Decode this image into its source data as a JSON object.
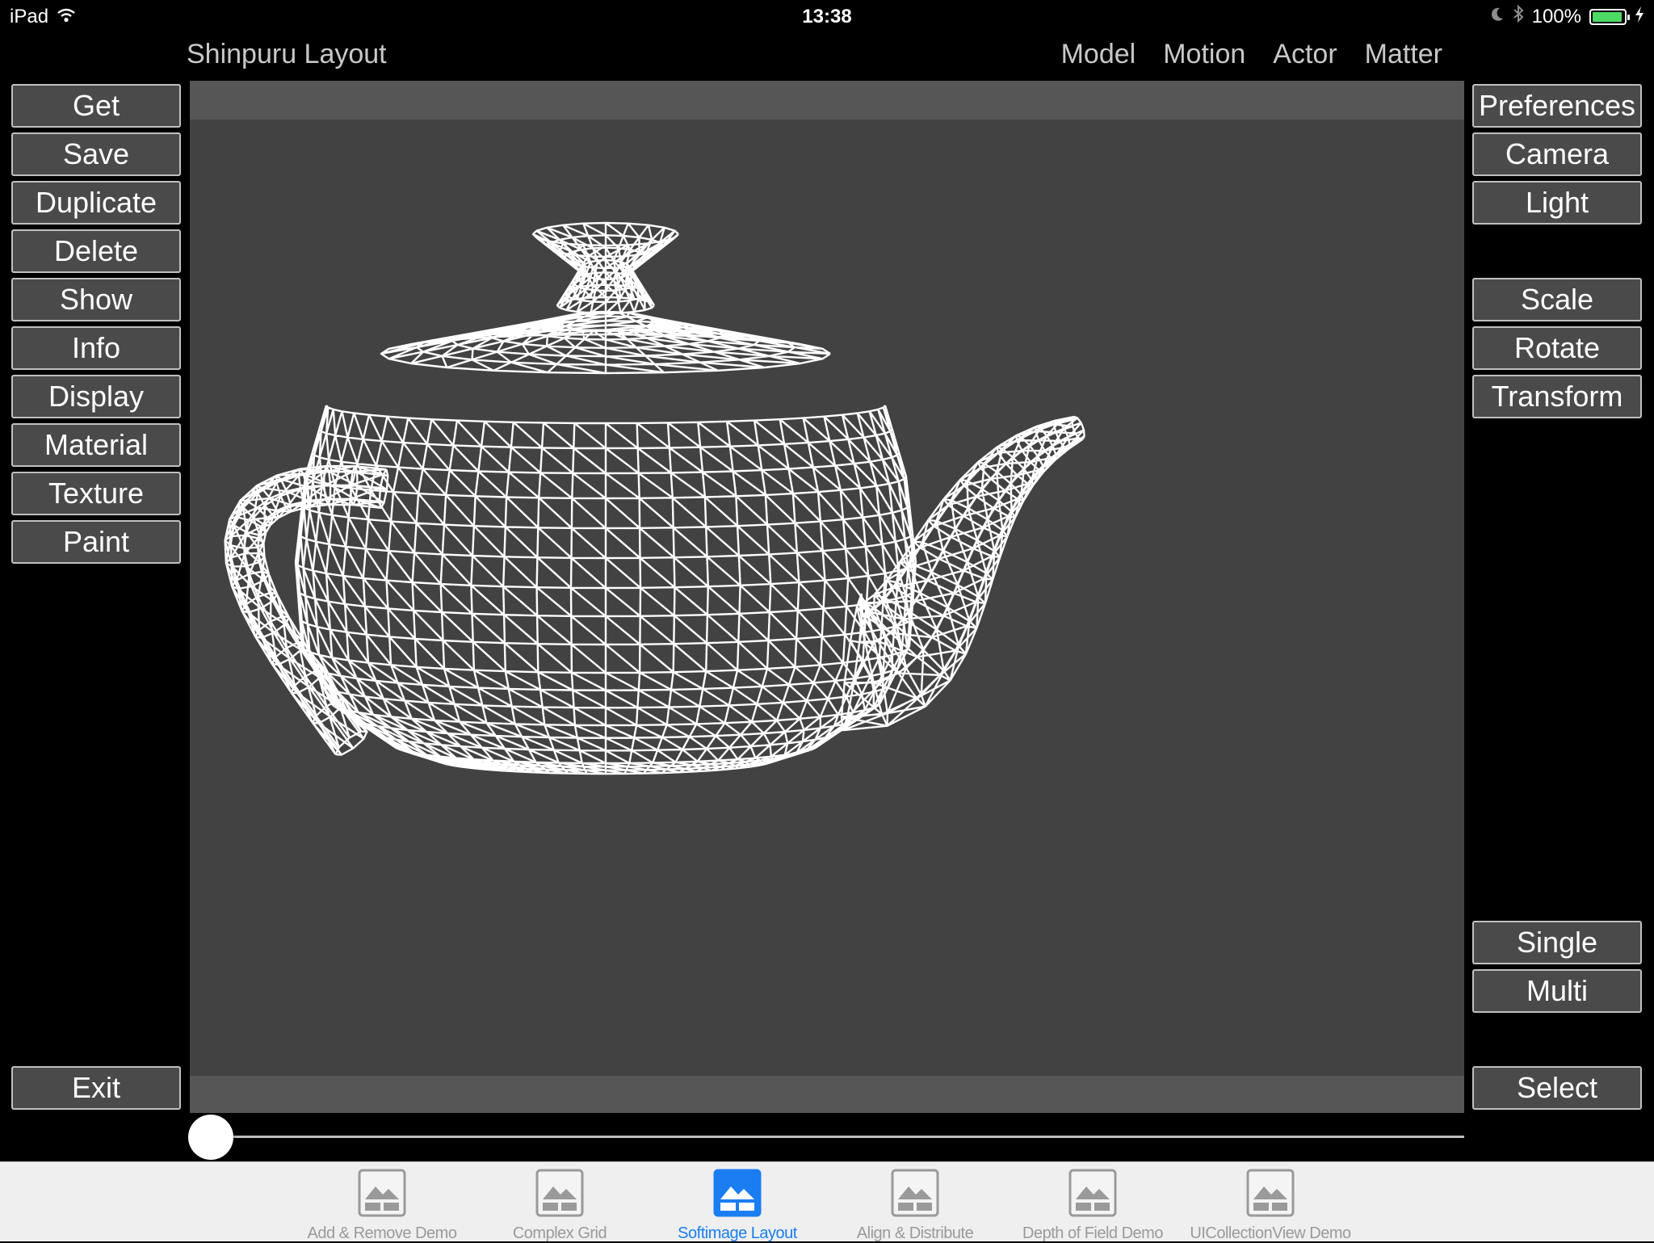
{
  "status_bar": {
    "device": "iPad",
    "time": "13:38",
    "battery": "100%"
  },
  "app": {
    "title": "Shinpuru Layout"
  },
  "menu": [
    "Model",
    "Motion",
    "Actor",
    "Matter"
  ],
  "left_buttons": [
    "Get",
    "Save",
    "Duplicate",
    "Delete",
    "Show",
    "Info",
    "Display",
    "Material",
    "Texture",
    "Paint"
  ],
  "exit_button": "Exit",
  "right_buttons_top": [
    "Preferences",
    "Camera",
    "Light"
  ],
  "right_buttons_mid": [
    "Scale",
    "Rotate",
    "Transform"
  ],
  "right_buttons_bottom": [
    "Single",
    "Multi"
  ],
  "select_button": "Select",
  "slider": {
    "value": 0
  },
  "tabs": [
    {
      "label": "Add & Remove Demo",
      "active": false
    },
    {
      "label": "Complex Grid",
      "active": false
    },
    {
      "label": "Softimage Layout",
      "active": true
    },
    {
      "label": "Align & Distribute",
      "active": false
    },
    {
      "label": "Depth of Field Demo",
      "active": false
    },
    {
      "label": "UICollectionView Demo",
      "active": false
    }
  ],
  "colors": {
    "tab_active": "#1a7ef2",
    "tab_inactive": "#9a9a9a",
    "battery": "#4cd964"
  },
  "icons": {
    "wifi": "wifi-icon",
    "moon": "moon-icon",
    "bluetooth": "bluetooth-icon",
    "charging": "bolt-icon",
    "tab": "photo-icon"
  }
}
